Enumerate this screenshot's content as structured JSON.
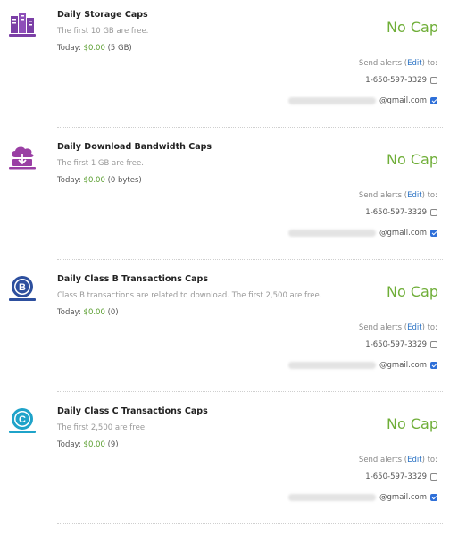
{
  "caps": [
    {
      "title": "Daily Storage Caps",
      "description": "The first 10 GB are free.",
      "today_label": "Today:",
      "today_amount": "$0.00",
      "today_detail": "(5 GB)",
      "cap_value": "No Cap",
      "icon": "storage-icon",
      "alerts_prefix": "Send alerts (",
      "alerts_edit": "Edit",
      "alerts_suffix": ") to:",
      "phone": "1-650-597-3329",
      "phone_checked": false,
      "email_domain": "@gmail.com",
      "email_checked": true
    },
    {
      "title": "Daily Download Bandwidth Caps",
      "description": "The first 1 GB are free.",
      "today_label": "Today:",
      "today_amount": "$0.00",
      "today_detail": "(0 bytes)",
      "cap_value": "No Cap",
      "icon": "cloud-download-icon",
      "alerts_prefix": "Send alerts (",
      "alerts_edit": "Edit",
      "alerts_suffix": ") to:",
      "phone": "1-650-597-3329",
      "phone_checked": false,
      "email_domain": "@gmail.com",
      "email_checked": true
    },
    {
      "title": "Daily Class B Transactions Caps",
      "description": "Class B transactions are related to download. The first 2,500 are free.",
      "today_label": "Today:",
      "today_amount": "$0.00",
      "today_detail": "(0)",
      "cap_value": "No Cap",
      "icon": "class-b-icon",
      "icon_letter": "B",
      "alerts_prefix": "Send alerts (",
      "alerts_edit": "Edit",
      "alerts_suffix": ") to:",
      "phone": "1-650-597-3329",
      "phone_checked": false,
      "email_domain": "@gmail.com",
      "email_checked": true
    },
    {
      "title": "Daily Class C Transactions Caps",
      "description": "The first 2,500 are free.",
      "today_label": "Today:",
      "today_amount": "$0.00",
      "today_detail": "(9)",
      "cap_value": "No Cap",
      "icon": "class-c-icon",
      "icon_letter": "C",
      "alerts_prefix": "Send alerts (",
      "alerts_edit": "Edit",
      "alerts_suffix": ") to:",
      "phone": "1-650-597-3329",
      "phone_checked": false,
      "email_domain": "@gmail.com",
      "email_checked": true
    }
  ],
  "colors": {
    "accent_green": "#6fae38",
    "money_green": "#5a9e2f",
    "link_blue": "#2a72c4",
    "storage_purple": "#7b3fa6",
    "download_purple": "#9a3fa4",
    "class_b_blue": "#2d4f9e",
    "class_c_cyan": "#1fa3c9"
  }
}
